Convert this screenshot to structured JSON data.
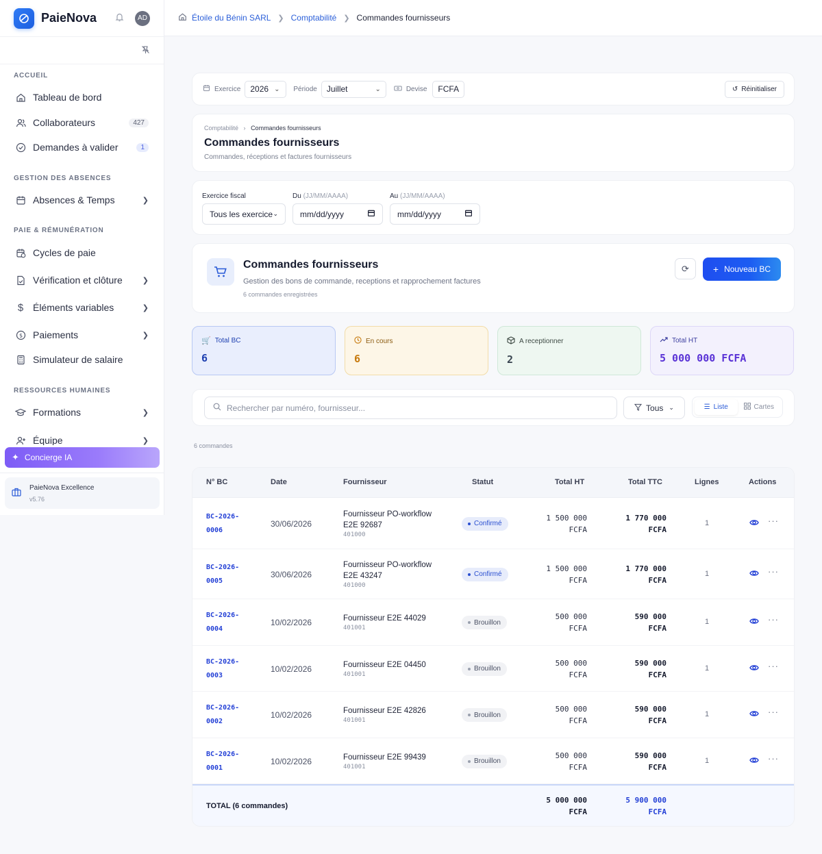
{
  "app": {
    "brand": "PaieNova",
    "avatar": "AD"
  },
  "sidebar": {
    "sections": [
      "ACCUEIL",
      "GESTION DES ABSENCES",
      "PAIE & RÉMUNÉRATION",
      "RESSOURCES HUMAINES"
    ],
    "items": [
      {
        "label": "Tableau de bord",
        "badge": ""
      },
      {
        "label": "Collaborateurs",
        "badge": "427"
      },
      {
        "label": "Demandes à valider",
        "badge": "1"
      },
      {
        "label": "Absences & Temps"
      },
      {
        "label": "Cycles de paie"
      },
      {
        "label": "Vérification et clôture"
      },
      {
        "label": "Éléments variables"
      },
      {
        "label": "Paiements"
      },
      {
        "label": "Simulateur de salaire"
      },
      {
        "label": "Formations"
      },
      {
        "label": "Équipe"
      }
    ],
    "concierge": "Concierge IA",
    "company_name": "PaieNova Excellence",
    "version": "v5.76"
  },
  "breadcrumb": {
    "company": "Étoile du Bénin SARL",
    "section": "Comptabilité",
    "current": "Commandes fournisseurs"
  },
  "filterbar": {
    "exercice_label": "Exercice",
    "exercice_value": "2026",
    "periode_label": "Période",
    "periode_value": "Juillet",
    "devise_label": "Devise",
    "devise_value": "FCFA",
    "reset_label": "Réinitialiser"
  },
  "page": {
    "crumb_parent": "Comptabilité",
    "crumb_current": "Commandes fournisseurs",
    "title": "Commandes fournisseurs",
    "subtitle": "Commandes, réceptions et factures fournisseurs"
  },
  "filters": {
    "exercice_label": "Exercice fiscal",
    "exercice_value": "Tous les exercices",
    "du_label": "Du",
    "du_hint": "(JJ/MM/AAAA)",
    "du_value": "mm/dd/yyyy",
    "au_label": "Au",
    "au_hint": "(JJ/MM/AAAA)",
    "au_value": "mm/dd/yyyy"
  },
  "hero": {
    "title": "Commandes fournisseurs",
    "subtitle": "Gestion des bons de commande, receptions et rapprochement factures",
    "count": "6 commandes enregistrées",
    "new_label": "Nouveau BC"
  },
  "stats": [
    {
      "label": "Total BC",
      "value": "6"
    },
    {
      "label": "En cours",
      "value": "6"
    },
    {
      "label": "A receptionner",
      "value": "2"
    },
    {
      "label": "Total HT",
      "value": "5 000 000 FCFA"
    }
  ],
  "search": {
    "placeholder": "Rechercher par numéro, fournisseur...",
    "filter_label": "Tous",
    "view_list": "Liste",
    "view_cards": "Cartes"
  },
  "list_count": "6 commandes",
  "table": {
    "headers": [
      "N° BC",
      "Date",
      "Fournisseur",
      "Statut",
      "Total HT",
      "Total TTC",
      "Lignes",
      "Actions"
    ],
    "rows": [
      {
        "num1": "BC-2026-",
        "num2": "0006",
        "date": "30/06/2026",
        "supp1": "Fournisseur PO-workflow",
        "supp2": "E2E 92687",
        "acct": "401000",
        "status": "Confirmé",
        "ht1": "1 500 000",
        "ht2": "FCFA",
        "ttc1": "1 770 000",
        "ttc2": "FCFA",
        "lines": "1"
      },
      {
        "num1": "BC-2026-",
        "num2": "0005",
        "date": "30/06/2026",
        "supp1": "Fournisseur PO-workflow",
        "supp2": "E2E 43247",
        "acct": "401000",
        "status": "Confirmé",
        "ht1": "1 500 000",
        "ht2": "FCFA",
        "ttc1": "1 770 000",
        "ttc2": "FCFA",
        "lines": "1"
      },
      {
        "num1": "BC-2026-",
        "num2": "0004",
        "date": "10/02/2026",
        "supp1": "Fournisseur E2E 44029",
        "supp2": "",
        "acct": "401001",
        "status": "Brouillon",
        "ht1": "500 000",
        "ht2": "FCFA",
        "ttc1": "590 000",
        "ttc2": "FCFA",
        "lines": "1"
      },
      {
        "num1": "BC-2026-",
        "num2": "0003",
        "date": "10/02/2026",
        "supp1": "Fournisseur E2E 04450",
        "supp2": "",
        "acct": "401001",
        "status": "Brouillon",
        "ht1": "500 000",
        "ht2": "FCFA",
        "ttc1": "590 000",
        "ttc2": "FCFA",
        "lines": "1"
      },
      {
        "num1": "BC-2026-",
        "num2": "0002",
        "date": "10/02/2026",
        "supp1": "Fournisseur E2E 42826",
        "supp2": "",
        "acct": "401001",
        "status": "Brouillon",
        "ht1": "500 000",
        "ht2": "FCFA",
        "ttc1": "590 000",
        "ttc2": "FCFA",
        "lines": "1"
      },
      {
        "num1": "BC-2026-",
        "num2": "0001",
        "date": "10/02/2026",
        "supp1": "Fournisseur E2E 99439",
        "supp2": "",
        "acct": "401001",
        "status": "Brouillon",
        "ht1": "500 000",
        "ht2": "FCFA",
        "ttc1": "590 000",
        "ttc2": "FCFA",
        "lines": "1"
      }
    ],
    "total_label": "TOTAL (6 commandes)",
    "total_ht1": "5 000 000",
    "total_ht2": "FCFA",
    "total_ttc1": "5 900 000",
    "total_ttc2": "FCFA"
  },
  "colors": {
    "accent": "#2340d6",
    "primary_button": "#1f4ef0",
    "concierge": "#7d5cf6"
  }
}
